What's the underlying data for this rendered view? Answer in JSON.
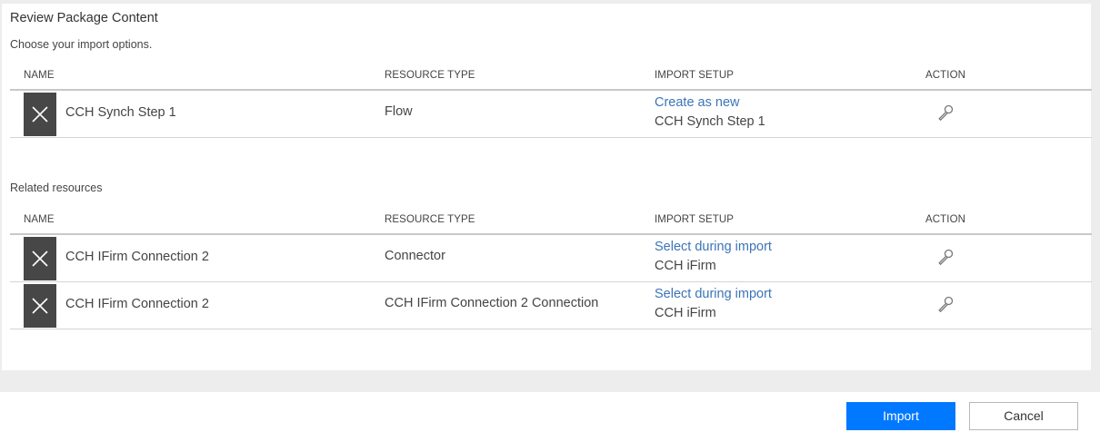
{
  "dialog": {
    "title": "Review Package Content",
    "subtitle": "Choose your import options."
  },
  "columns": {
    "name": "NAME",
    "resource_type": "RESOURCE TYPE",
    "import_setup": "IMPORT SETUP",
    "action": "ACTION"
  },
  "package_rows": [
    {
      "icon": "close-x-icon",
      "name": "CCH Synch Step 1",
      "resource_type": "Flow",
      "setup_link": "Create as new",
      "setup_value": "CCH Synch Step 1",
      "action_icon": "wrench-icon"
    }
  ],
  "related": {
    "label": "Related resources",
    "rows": [
      {
        "icon": "close-x-icon",
        "name": "CCH IFirm Connection 2",
        "resource_type": "Connector",
        "setup_link": "Select during import",
        "setup_value": "CCH iFirm",
        "action_icon": "wrench-icon"
      },
      {
        "icon": "close-x-icon",
        "name": "CCH IFirm Connection 2",
        "resource_type": "CCH IFirm Connection 2 Connection",
        "setup_link": "Select during import",
        "setup_value": "CCH iFirm",
        "action_icon": "wrench-icon"
      }
    ]
  },
  "footer": {
    "import_label": "Import",
    "cancel_label": "Cancel"
  },
  "colors": {
    "primary": "#0078ff",
    "link": "#3b74b8",
    "icon_tile": "#474747"
  }
}
